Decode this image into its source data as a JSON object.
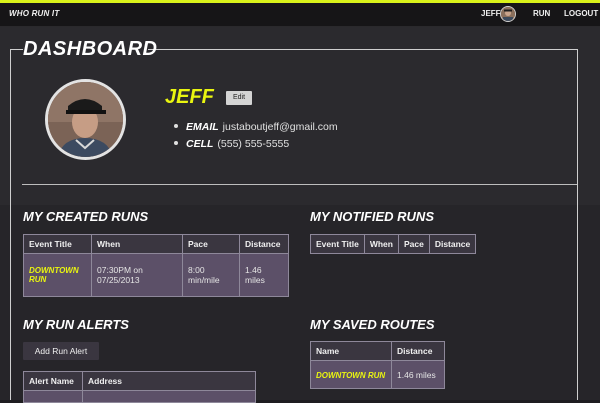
{
  "nav": {
    "brand": "WHO RUN IT",
    "user": "JEFF",
    "run": "RUN",
    "logout": "LOGOUT"
  },
  "colors": {
    "accent": "#e9f510",
    "topbar": "#161517",
    "panel": "#2b2a2e",
    "table_header": "#3a3640",
    "table_row": "#5c5068"
  },
  "page": {
    "title": "DASHBOARD"
  },
  "profile": {
    "name": "JEFF",
    "edit_label": "Edit",
    "email_key": "EMAIL",
    "email": "justaboutjeff@gmail.com",
    "cell_key": "CELL",
    "cell": "(555) 555-5555"
  },
  "created_runs": {
    "title": "MY CREATED RUNS",
    "headers": [
      "Event Title",
      "When",
      "Pace",
      "Distance"
    ],
    "rows": [
      {
        "event_title_line1": "DOWNTOWN",
        "event_title_line2": "RUN",
        "when_line1": "07:30PM on",
        "when_line2": "07/25/2013",
        "pace_line1": "8:00",
        "pace_line2": "min/mile",
        "distance_line1": "1.46",
        "distance_line2": "miles"
      }
    ]
  },
  "notified_runs": {
    "title": "MY NOTIFIED RUNS",
    "headers": [
      "Event Title",
      "When",
      "Pace",
      "Distance"
    ]
  },
  "run_alerts": {
    "title": "MY RUN ALERTS",
    "add_button": "Add Run Alert",
    "headers": [
      "Alert Name",
      "Address"
    ]
  },
  "saved_routes": {
    "title": "MY SAVED ROUTES",
    "headers": [
      "Name",
      "Distance"
    ],
    "rows": [
      {
        "name": "DOWNTOWN RUN",
        "distance": "1.46 miles"
      }
    ]
  }
}
